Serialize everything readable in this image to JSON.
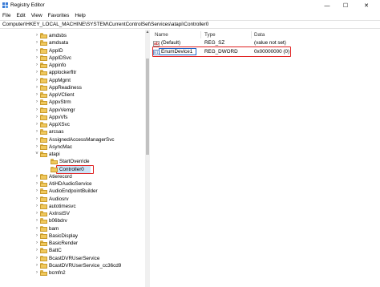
{
  "window": {
    "title": "Registry Editor",
    "minimize_glyph": "—",
    "maximize_glyph": "☐",
    "close_glyph": "✕"
  },
  "menu": [
    "File",
    "Edit",
    "View",
    "Favorites",
    "Help"
  ],
  "address": "Computer\\HKEY_LOCAL_MACHINE\\SYSTEM\\CurrentControlSet\\Services\\atapi\\Controller0",
  "tree": {
    "items": [
      {
        "label": "amdsbs",
        "expander": true,
        "level": 0
      },
      {
        "label": "amdsata",
        "expander": true,
        "level": 0
      },
      {
        "label": "AppID",
        "expander": true,
        "level": 0
      },
      {
        "label": "AppIDSvc",
        "expander": true,
        "level": 0
      },
      {
        "label": "Appinfo",
        "expander": true,
        "level": 0
      },
      {
        "label": "applockerfltr",
        "expander": true,
        "level": 0
      },
      {
        "label": "AppMgmt",
        "expander": true,
        "level": 0
      },
      {
        "label": "AppReadiness",
        "expander": true,
        "level": 0
      },
      {
        "label": "AppVClient",
        "expander": true,
        "level": 0
      },
      {
        "label": "AppvStrm",
        "expander": true,
        "level": 0
      },
      {
        "label": "AppvVemgr",
        "expander": true,
        "level": 0
      },
      {
        "label": "AppvVfs",
        "expander": true,
        "level": 0
      },
      {
        "label": "AppXSvc",
        "expander": true,
        "level": 0
      },
      {
        "label": "arcsas",
        "expander": true,
        "level": 0
      },
      {
        "label": "AssignedAccessManagerSvc",
        "expander": true,
        "level": 0
      },
      {
        "label": "AsyncMac",
        "expander": true,
        "level": 0
      },
      {
        "label": "atapi",
        "expander": "open",
        "level": 0
      },
      {
        "label": "StartOverride",
        "expander": false,
        "level": 1
      },
      {
        "label": "Controller0",
        "expander": false,
        "level": 1,
        "selected": true
      },
      {
        "label": "Atierecord",
        "expander": true,
        "level": 0
      },
      {
        "label": "AtiHDAudioService",
        "expander": true,
        "level": 0
      },
      {
        "label": "AudioEndpointBuilder",
        "expander": true,
        "level": 0
      },
      {
        "label": "Audiosrv",
        "expander": true,
        "level": 0
      },
      {
        "label": "autotimesvc",
        "expander": true,
        "level": 0
      },
      {
        "label": "AxInstSV",
        "expander": true,
        "level": 0
      },
      {
        "label": "b06bdrv",
        "expander": true,
        "level": 0
      },
      {
        "label": "bam",
        "expander": true,
        "level": 0
      },
      {
        "label": "BasicDisplay",
        "expander": true,
        "level": 0
      },
      {
        "label": "BasicRender",
        "expander": true,
        "level": 0
      },
      {
        "label": "BattC",
        "expander": true,
        "level": 0
      },
      {
        "label": "BcastDVRUserService",
        "expander": true,
        "level": 0
      },
      {
        "label": "BcastDVRUserService_cc36cd9",
        "expander": true,
        "level": 0
      },
      {
        "label": "bcmfn2",
        "expander": true,
        "level": 0
      }
    ]
  },
  "list": {
    "columns": {
      "name": "Name",
      "type": "Type",
      "data": "Data"
    },
    "rows": [
      {
        "icon": "string-value-icon",
        "icon_glyph": "ab",
        "name": "(Default)",
        "type": "REG_SZ",
        "data": "(value not set)"
      },
      {
        "icon": "binary-value-icon",
        "icon_glyph": "011",
        "name": "EnumDevice1",
        "type": "REG_DWORD",
        "data": "0x00000000 (0)",
        "highlighted": true
      }
    ]
  },
  "colors": {
    "highlight_border": "#e02020",
    "selection_fill": "#cce4f7",
    "folder": "#f0c85c"
  }
}
